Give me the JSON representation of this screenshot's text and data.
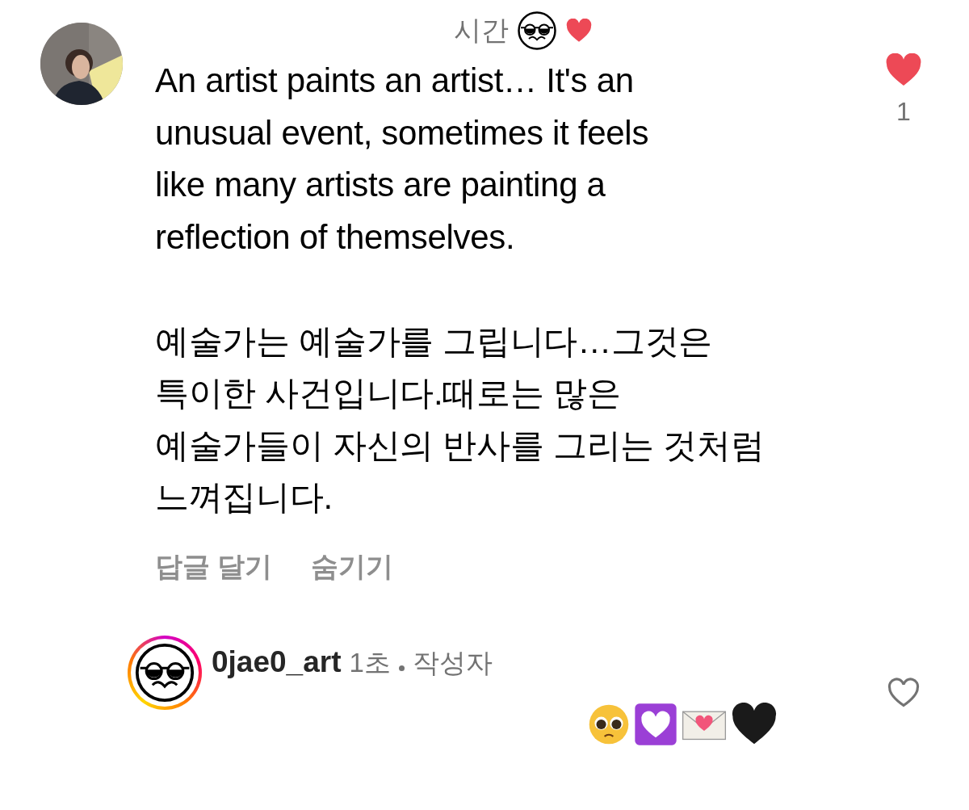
{
  "comments": [
    {
      "time": "시간",
      "liked": true,
      "like_count": "1",
      "text": "An artist paints an artist… It's an\nunusual event, sometimes it feels\nlike many artists are painting a\nreflection of themselves.\n\n예술가는 예술가를 그립니다…그것은\n특이한 사건입니다.때로는 많은\n예술가들이 자신의 반사를 그리는 것처럼\n느껴집니다.",
      "actions": [
        "답글 달기",
        "숨기기"
      ]
    },
    {
      "username": "0jae0_art",
      "time": "1초",
      "badge": "작성자",
      "liked": false
    }
  ]
}
